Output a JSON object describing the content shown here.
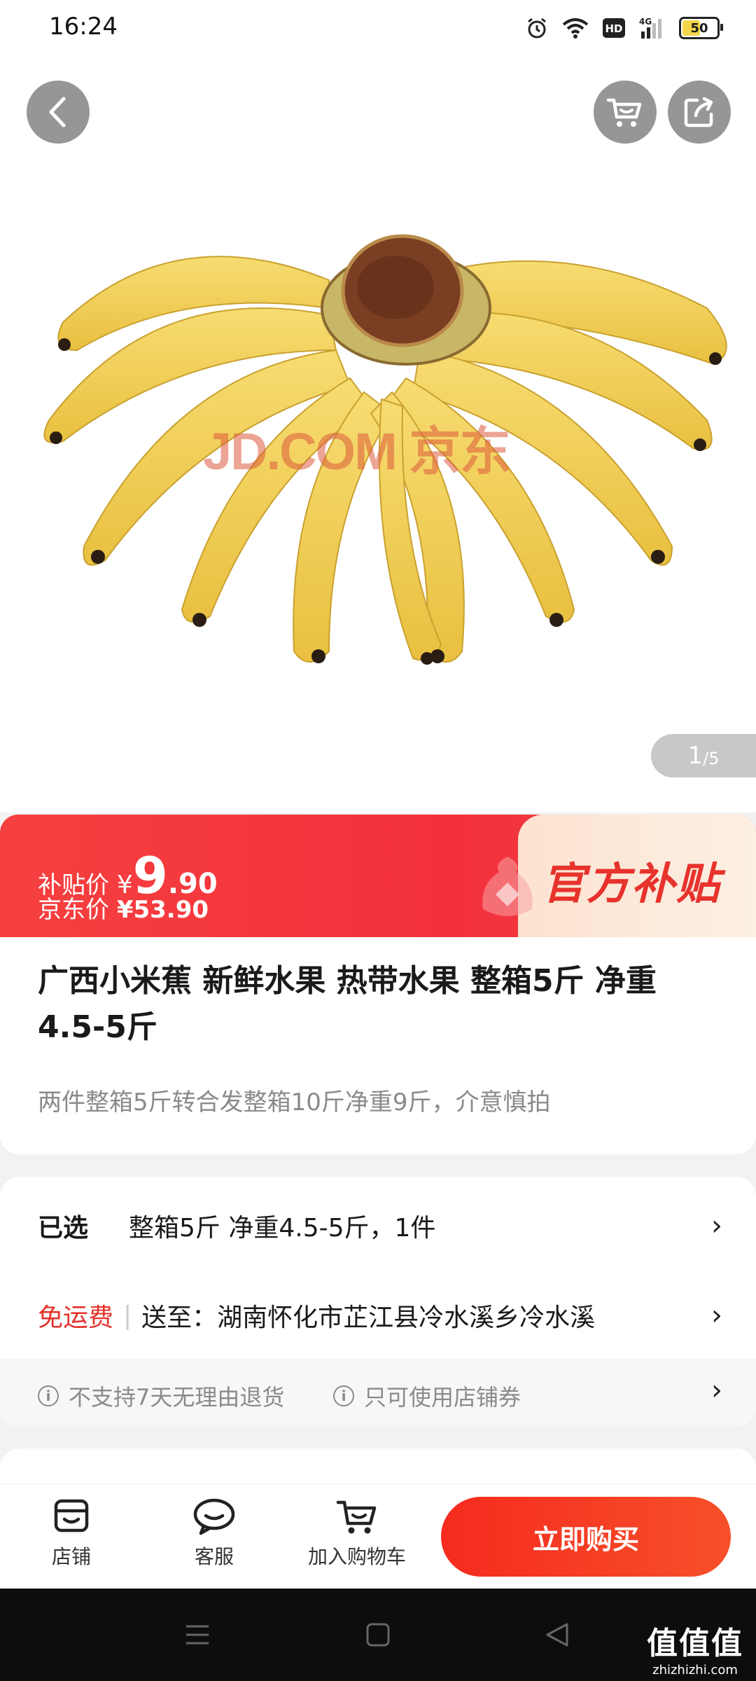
{
  "status_bar": {
    "time": "16:24",
    "battery": "50",
    "icons": [
      "alarm-icon",
      "wifi-icon",
      "hd-icon",
      "4g-signal-icon",
      "battery-icon"
    ]
  },
  "hero": {
    "watermark": "JD.COM 京东",
    "page_current": "1",
    "page_total": "/5"
  },
  "price": {
    "subsidy_label": "补贴价",
    "currency": "¥",
    "subsidy_int": "9",
    "subsidy_dec": ".90",
    "jd_label": "京东价",
    "jd_value": "¥53.90",
    "official_badge": "官方补贴"
  },
  "product": {
    "title": "广西小米蕉 新鲜水果 热带水果 整箱5斤 净重4.5-5斤",
    "subtitle": "两件整箱5斤转合发整箱10斤净重9斤，介意慎拍"
  },
  "spec": {
    "selected_label": "已选",
    "selected_value": "整箱5斤 净重4.5-5斤，1件",
    "shipping_label": "免运费",
    "deliver_to": "送至：湖南怀化市芷江县冷水溪乡冷水溪",
    "notice_1": "不支持7天无理由退货",
    "notice_2": "只可使用店铺券"
  },
  "bottom": {
    "store": "店铺",
    "service": "客服",
    "add_cart": "加入购物车",
    "buy_now": "立即购买"
  },
  "corner_watermark": {
    "big": "值值值",
    "small": "zhizhizhi.com"
  },
  "colors": {
    "accent_red": "#f2303c",
    "buy_button": "#f52a1e",
    "banana_yellow": "#f2d157"
  }
}
